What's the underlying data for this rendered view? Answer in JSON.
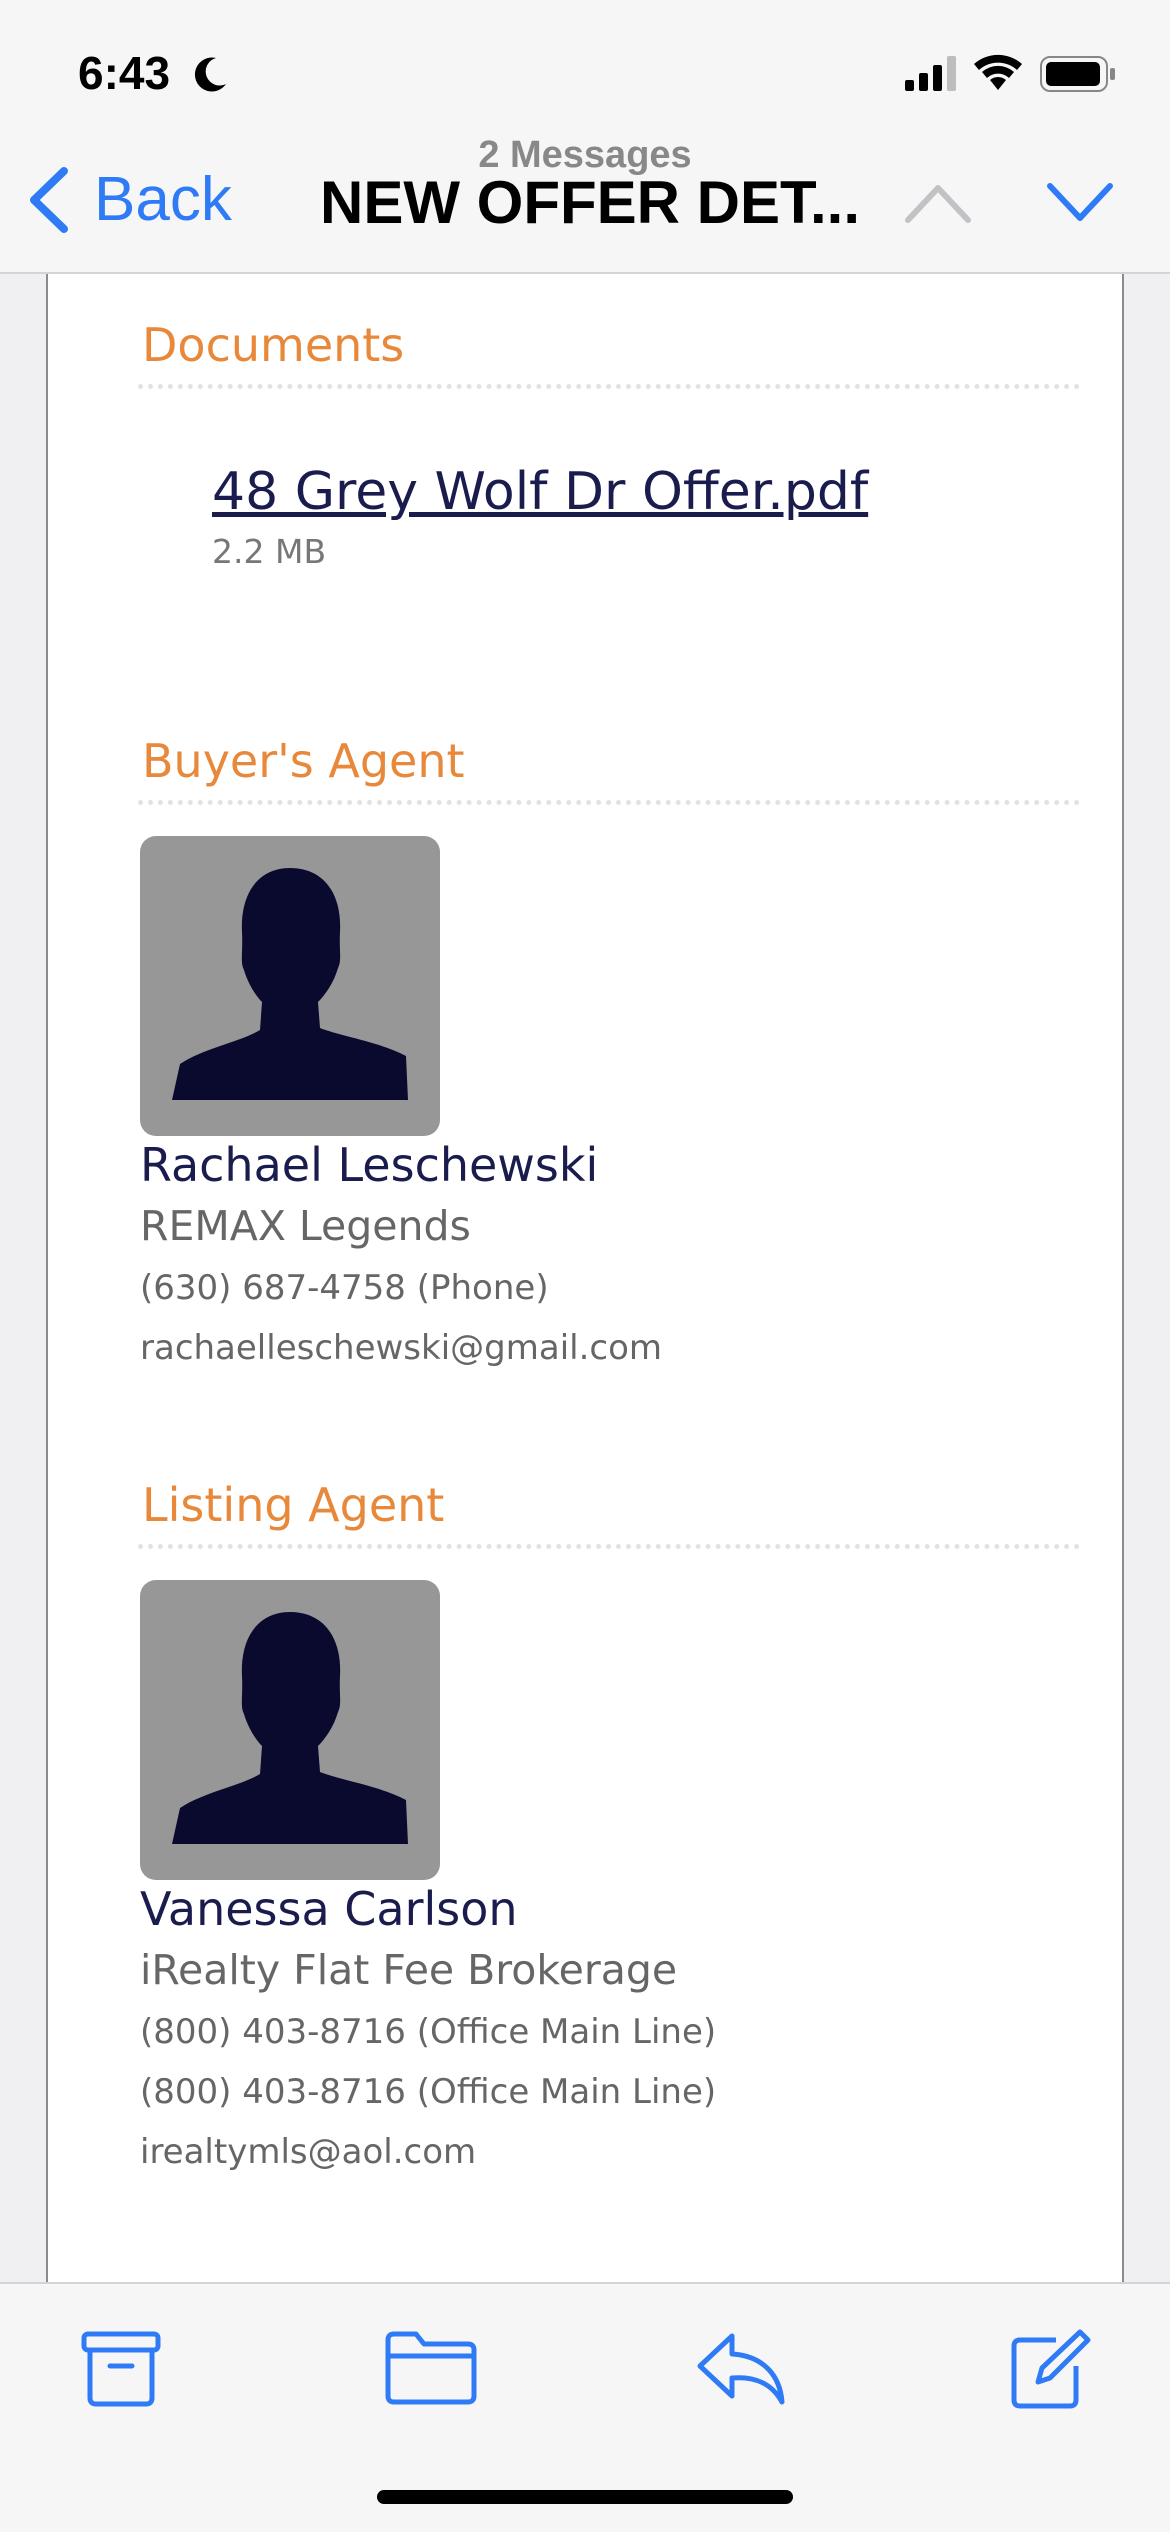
{
  "status": {
    "time": "6:43"
  },
  "nav": {
    "back_label": "Back",
    "message_count": "2 Messages",
    "title": "NEW OFFER DET..."
  },
  "documents": {
    "heading": "Documents",
    "file_name": "48 Grey Wolf Dr Offer.pdf",
    "file_size": "2.2 MB"
  },
  "buyers_agent": {
    "heading": "Buyer's Agent",
    "name": "Rachael Leschewski",
    "company": "REMAX Legends",
    "phone": "(630) 687-4758 (Phone)",
    "email": "rachaelleschewski@gmail.com"
  },
  "listing_agent": {
    "heading": "Listing Agent",
    "name": "Vanessa Carlson",
    "company": "iRealty Flat Fee Brokerage",
    "phone1": "(800) 403-8716 (Office Main Line)",
    "phone2": "(800) 403-8716 (Office Main Line)",
    "email": "irealtymls@aol.com"
  },
  "colors": {
    "accent": "#2f7bf6",
    "section_heading": "#e8883a",
    "name_text": "#1a1c4e",
    "avatar_bg": "#979797"
  },
  "toolbar": {
    "icons": [
      "archive-icon",
      "folder-icon",
      "reply-icon",
      "compose-icon"
    ]
  }
}
